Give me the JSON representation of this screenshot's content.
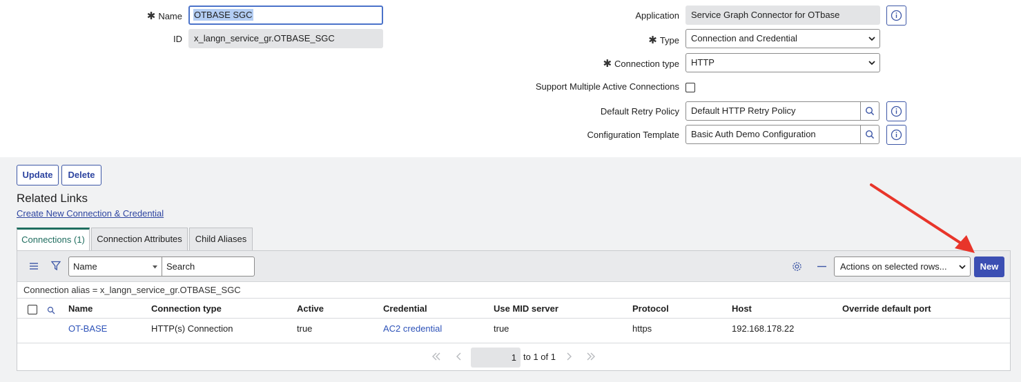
{
  "form": {
    "name_label": "Name",
    "name_value": "OTBASE SGC",
    "id_label": "ID",
    "id_value": "x_langn_service_gr.OTBASE_SGC",
    "application_label": "Application",
    "application_value": "Service Graph Connector for OTbase",
    "type_label": "Type",
    "type_value": "Connection and Credential",
    "connection_type_label": "Connection type",
    "connection_type_value": "HTTP",
    "support_multiple_label": "Support Multiple Active Connections",
    "support_multiple_checked": false,
    "retry_policy_label": "Default Retry Policy",
    "retry_policy_value": "Default HTTP Retry Policy",
    "config_template_label": "Configuration Template",
    "config_template_value": "Basic Auth Demo Configuration"
  },
  "actions": {
    "update_label": "Update",
    "delete_label": "Delete"
  },
  "related_links": {
    "title": "Related Links",
    "create_link": "Create New Connection & Credential"
  },
  "tabs": [
    {
      "label": "Connections (1)",
      "active": true
    },
    {
      "label": "Connection Attributes",
      "active": false
    },
    {
      "label": "Child Aliases",
      "active": false
    }
  ],
  "list": {
    "search_field_value": "Name",
    "search_placeholder": "Search",
    "actions_select": "Actions on selected rows...",
    "new_label": "New",
    "filter_text": "Connection alias = x_langn_service_gr.OTBASE_SGC",
    "columns": [
      "Name",
      "Connection type",
      "Active",
      "Credential",
      "Use MID server",
      "Protocol",
      "Host",
      "Override default port"
    ],
    "rows": [
      {
        "name": "OT-BASE",
        "connection_type": "HTTP(s) Connection",
        "active": "true",
        "credential": "AC2 credential",
        "use_mid": "true",
        "protocol": "https",
        "host": "192.168.178.22",
        "override_port": ""
      }
    ],
    "pager": {
      "current_page": "1",
      "range_text": "to 1 of 1"
    }
  },
  "colors": {
    "accent_blue": "#3c56a6",
    "new_button_bg": "#3b4eb3",
    "active_tab_green": "#1f6d5f",
    "link_blue": "#2d52b8",
    "annotation_arrow": "#e8352a"
  },
  "icons": [
    "info-icon",
    "search-icon",
    "list-menu-icon",
    "filter-icon",
    "gear-icon",
    "minus-icon",
    "first-page-icon",
    "prev-page-icon",
    "next-page-icon",
    "last-page-icon",
    "chevron-down-icon",
    "annotation-arrow-icon"
  ]
}
